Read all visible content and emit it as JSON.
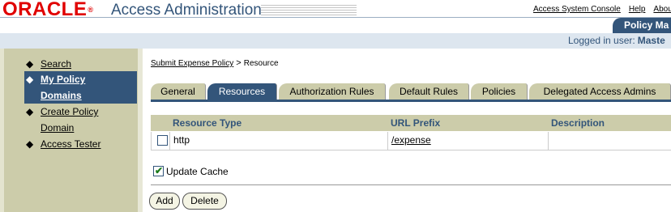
{
  "header": {
    "logo_text": "ORACLE",
    "logo_mark": "®",
    "app_title": "Access Administration",
    "top_links": [
      "Access System Console",
      "Help",
      "About"
    ],
    "policy_tab_label": "Policy Ma",
    "login_label": "Logged in user:",
    "login_user": "Maste"
  },
  "sidebar": {
    "items": [
      {
        "label": "Search",
        "selected": false
      },
      {
        "label_line1": "My Policy",
        "label_line2": "Domains",
        "selected": true
      },
      {
        "label_line1": "Create Policy",
        "label_line2": "Domain",
        "selected": false
      },
      {
        "label": "Access Tester",
        "selected": false
      }
    ],
    "bullet": "◆"
  },
  "breadcrumb": {
    "link": "Submit Expense Policy",
    "separator": ">",
    "current": "Resource"
  },
  "tabs": [
    {
      "label": "General",
      "active": false
    },
    {
      "label": "Resources",
      "active": true
    },
    {
      "label": "Authorization Rules",
      "active": false
    },
    {
      "label": "Default Rules",
      "active": false
    },
    {
      "label": "Policies",
      "active": false
    },
    {
      "label": "Delegated Access Admins",
      "active": false
    }
  ],
  "table": {
    "columns": [
      "Resource Type",
      "URL Prefix",
      "Description"
    ],
    "rows": [
      {
        "checked": false,
        "resource_type": "http",
        "url_prefix": "/expense",
        "description": ""
      }
    ]
  },
  "update_cache": {
    "label": "Update Cache",
    "checked": true,
    "check_glyph": "✔"
  },
  "buttons": {
    "add": "Add",
    "delete": "Delete"
  },
  "colors": {
    "brand_red": "#e00000",
    "accent_blue": "#33557a",
    "sidebar_bg": "#ccccaa",
    "login_bar_bg": "#dde6ef"
  }
}
